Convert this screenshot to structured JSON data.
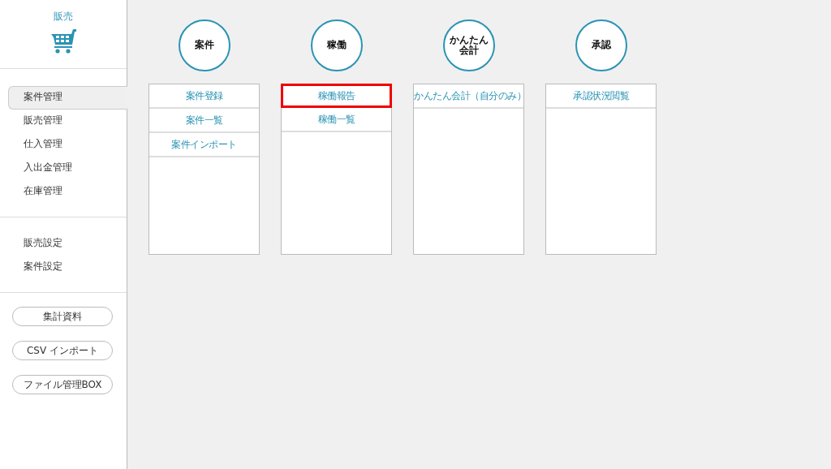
{
  "sidebar": {
    "title": "販売",
    "nav_items": [
      {
        "label": "案件管理",
        "selected": true
      },
      {
        "label": "販売管理",
        "selected": false
      },
      {
        "label": "仕入管理",
        "selected": false
      },
      {
        "label": "入出金管理",
        "selected": false
      },
      {
        "label": "在庫管理",
        "selected": false
      }
    ],
    "settings_items": [
      {
        "label": "販売設定"
      },
      {
        "label": "案件設定"
      }
    ],
    "buttons": [
      "集計資料",
      "CSV インポート",
      "ファイル管理BOX"
    ]
  },
  "categories": [
    {
      "title": "案件",
      "links": [
        {
          "label": "案件登録",
          "highlighted": false
        },
        {
          "label": "案件一覧",
          "highlighted": false
        },
        {
          "label": "案件インポート",
          "highlighted": false
        }
      ]
    },
    {
      "title": "稼働",
      "links": [
        {
          "label": "稼働報告",
          "highlighted": true
        },
        {
          "label": "稼働一覧",
          "highlighted": false
        }
      ]
    },
    {
      "title": "かんたん会計",
      "links": [
        {
          "label": "かんたん会計（自分のみ）",
          "highlighted": false
        }
      ]
    },
    {
      "title": "承認",
      "links": [
        {
          "label": "承認状況閲覧",
          "highlighted": false
        }
      ]
    }
  ]
}
